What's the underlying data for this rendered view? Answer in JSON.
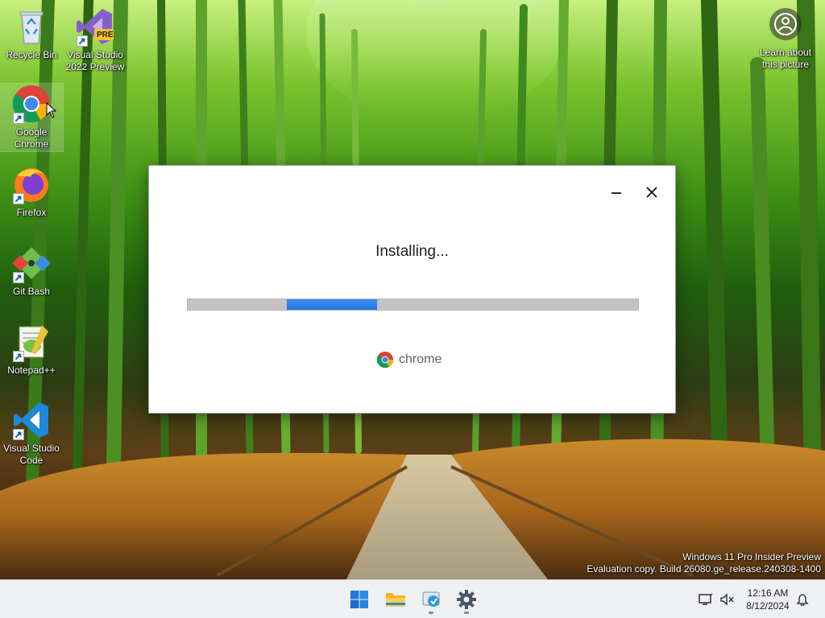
{
  "desktop": {
    "icons": [
      {
        "label": "Recycle Bin"
      },
      {
        "label": "Visual Studio 2022 Preview",
        "badge": "PRE"
      },
      {
        "label": "Google Chrome"
      },
      {
        "label": "Firefox"
      },
      {
        "label": "Git Bash"
      },
      {
        "label": "Notepad++"
      },
      {
        "label": "Visual Studio Code"
      }
    ],
    "learn_about": "Learn about this picture",
    "watermark": {
      "line1": "Windows 11 Pro Insider Preview",
      "line2": "Evaluation copy. Build 26080.ge_release.240308-1400"
    }
  },
  "installer": {
    "status": "Installing...",
    "progress_fraction": 0.22,
    "brand": "chrome"
  },
  "taskbar": {
    "apps": [
      "start-icon",
      "file-explorer-icon",
      "installer-app-icon",
      "settings-icon"
    ]
  },
  "tray": {
    "time": "12:16 AM",
    "date": "8/12/2024"
  },
  "colors": {
    "progress": "#2f80ed",
    "chrome_red": "#db4437",
    "chrome_yellow": "#f4b400",
    "chrome_green": "#0f9d58",
    "chrome_blue": "#4285f4"
  }
}
